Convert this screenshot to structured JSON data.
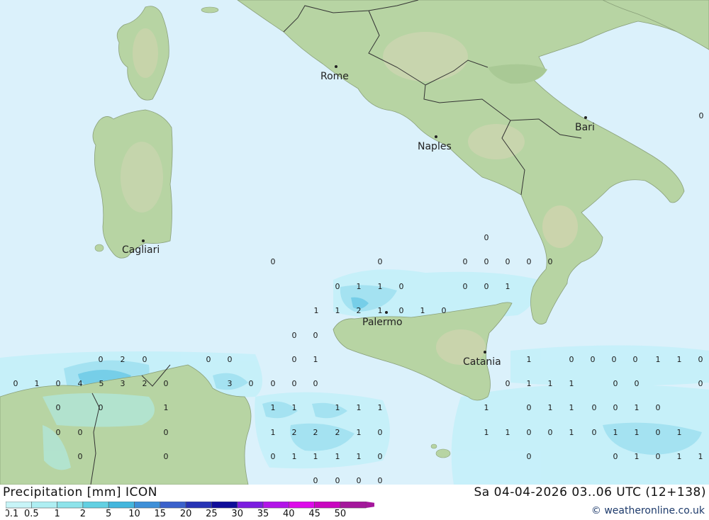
{
  "header": {
    "title": "Precipitation [mm] ICON",
    "run": "Sa 04-04-2026 03..06 UTC (12+138)",
    "credit": "© weatheronline.co.uk"
  },
  "legend": {
    "ticks": [
      "0.1",
      "0.5",
      "1",
      "2",
      "5",
      "10",
      "15",
      "20",
      "25",
      "30",
      "35",
      "40",
      "45",
      "50"
    ],
    "colors": [
      "#c7f4f7",
      "#aeeef2",
      "#8de3ea",
      "#62d0e2",
      "#43b6dd",
      "#3d8fd8",
      "#3a61cc",
      "#2633b5",
      "#0f0d9a",
      "#7b1de0",
      "#b214e8",
      "#dd0bea",
      "#c907c0",
      "#a5179c"
    ]
  },
  "map": {
    "colors": {
      "sea": "#dbf1fb",
      "land": "#b7d4a3",
      "rain_light": "#bfeef8",
      "rain_mid": "#96deef",
      "rain_heavy": "#6ccbe6"
    },
    "cities": [
      {
        "name": "Rome",
        "id": "rome"
      },
      {
        "name": "Naples",
        "id": "naples"
      },
      {
        "name": "Bari",
        "id": "bari"
      },
      {
        "name": "Cagliari",
        "id": "cagliari"
      },
      {
        "name": "Palermo",
        "id": "palermo"
      },
      {
        "name": "Catania",
        "id": "catania"
      }
    ],
    "values": [
      "0",
      "0",
      "0",
      "0",
      "0",
      "0",
      "0",
      "0",
      "0",
      "1",
      "1",
      "0",
      "0",
      "0",
      "1",
      "1",
      "1",
      "2",
      "1",
      "0",
      "1",
      "0",
      "0",
      "0",
      "0",
      "1",
      "1",
      "0",
      "0",
      "0",
      "0",
      "1",
      "1",
      "0",
      "0",
      "2",
      "0",
      "0",
      "0",
      "0",
      "1",
      "0",
      "1",
      "0",
      "4",
      "5",
      "3",
      "2",
      "0",
      "3",
      "0",
      "0",
      "0",
      "0",
      "0",
      "1",
      "1",
      "0",
      "0",
      "0",
      "0",
      "0",
      "1",
      "1",
      "1",
      "1",
      "1",
      "1",
      "1",
      "0",
      "1",
      "1",
      "0",
      "0",
      "1",
      "0",
      "0",
      "0",
      "0",
      "1",
      "2",
      "2",
      "2",
      "1",
      "0",
      "1",
      "1",
      "0",
      "0",
      "1",
      "0",
      "1",
      "1",
      "0",
      "1",
      "0",
      "0",
      "0",
      "1",
      "1",
      "1",
      "1",
      "0",
      "0",
      "0",
      "1",
      "0",
      "1",
      "1",
      "0",
      "0",
      "0",
      "0"
    ]
  }
}
